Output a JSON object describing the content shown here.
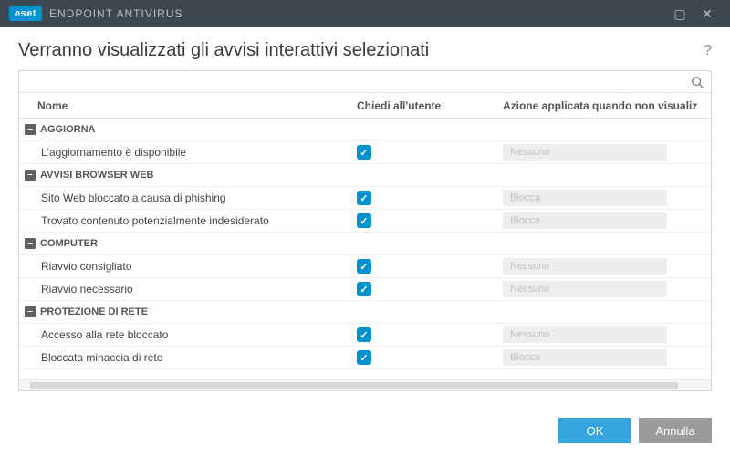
{
  "app": {
    "brand": "eset",
    "title": "ENDPOINT ANTIVIRUS"
  },
  "header": {
    "title": "Verranno visualizzati gli avvisi interattivi selezionati"
  },
  "search": {
    "placeholder": ""
  },
  "columns": {
    "name": "Nome",
    "ask": "Chiedi all'utente",
    "action": "Azione applicata quando non visualiz"
  },
  "groups": [
    {
      "label": "AGGIORNA",
      "items": [
        {
          "name": "L'aggiornamento è disponibile",
          "ask": true,
          "action": "Nessuno"
        }
      ]
    },
    {
      "label": "AVVISI BROWSER WEB",
      "items": [
        {
          "name": "Sito Web bloccato a causa di phishing",
          "ask": true,
          "action": "Blocca"
        },
        {
          "name": "Trovato contenuto potenzialmente indesiderato",
          "ask": true,
          "action": "Blocca"
        }
      ]
    },
    {
      "label": "COMPUTER",
      "items": [
        {
          "name": "Riavvio consigliato",
          "ask": true,
          "action": "Nessuno"
        },
        {
          "name": "Riavvio necessario",
          "ask": true,
          "action": "Nessuno"
        }
      ]
    },
    {
      "label": "PROTEZIONE DI RETE",
      "items": [
        {
          "name": "Accesso alla rete bloccato",
          "ask": true,
          "action": "Nessuno"
        },
        {
          "name": "Bloccata minaccia di rete",
          "ask": true,
          "action": "Blocca"
        }
      ]
    }
  ],
  "buttons": {
    "ok": "OK",
    "cancel": "Annulla"
  },
  "icons": {
    "collapse": "–",
    "check": "✓",
    "help": "?",
    "close": "✕",
    "maximize": "▢"
  }
}
